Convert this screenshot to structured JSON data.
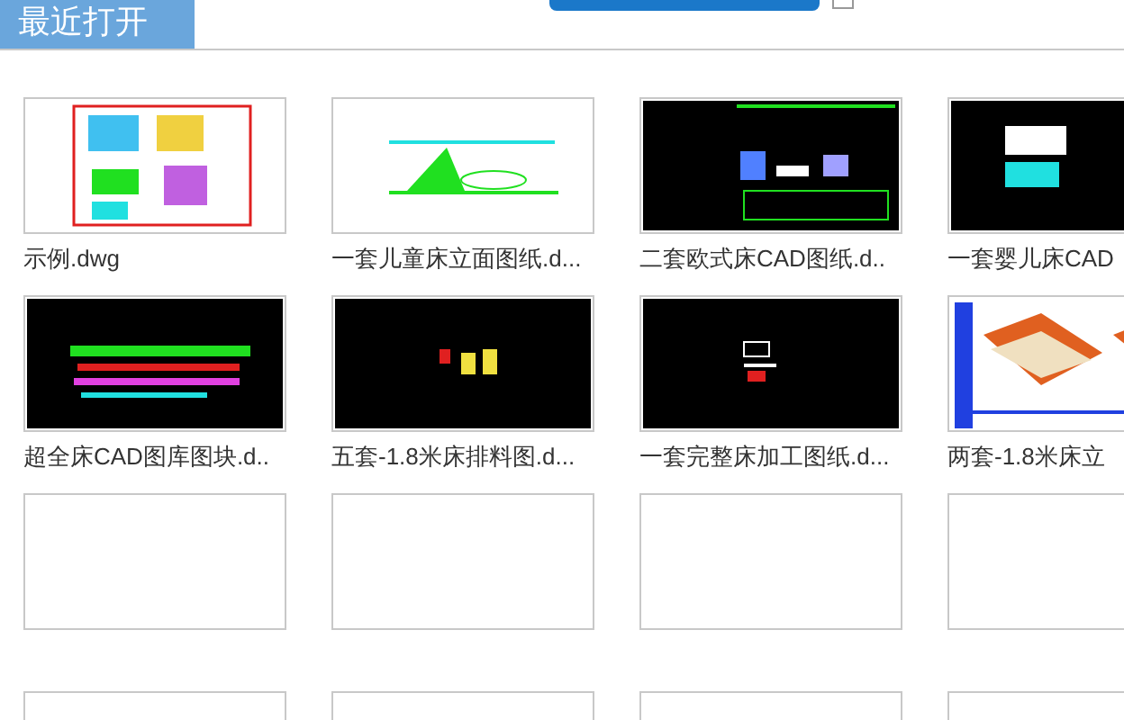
{
  "tab": {
    "label": "最近打开",
    "selected": true
  },
  "files": [
    {
      "kind": "file",
      "name": "示例.dwg"
    },
    {
      "kind": "file",
      "name": "一套儿童床立面图纸.d..."
    },
    {
      "kind": "file",
      "name": "二套欧式床CAD图纸.d.."
    },
    {
      "kind": "file",
      "name": "一套婴儿床CAD"
    },
    {
      "kind": "file",
      "name": "超全床CAD图库图块.d.."
    },
    {
      "kind": "file",
      "name": "五套-1.8米床排料图.d..."
    },
    {
      "kind": "file",
      "name": "一套完整床加工图纸.d..."
    },
    {
      "kind": "file",
      "name": "两套-1.8米床立"
    },
    {
      "kind": "empty"
    },
    {
      "kind": "empty"
    },
    {
      "kind": "empty"
    },
    {
      "kind": "empty"
    },
    {
      "kind": "empty"
    },
    {
      "kind": "empty"
    },
    {
      "kind": "empty"
    },
    {
      "kind": "empty"
    }
  ]
}
